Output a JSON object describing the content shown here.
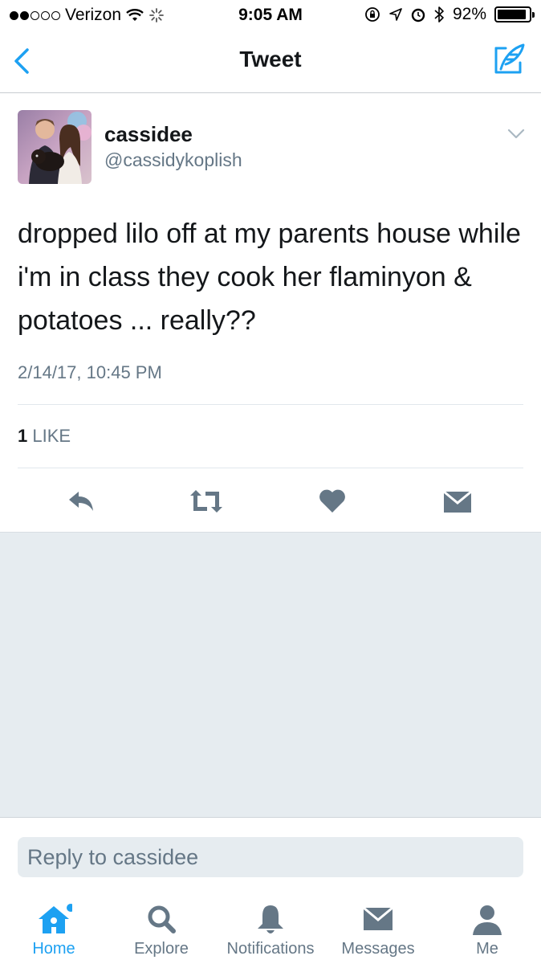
{
  "status_bar": {
    "carrier": "Verizon",
    "time": "9:05 AM",
    "battery": "92%",
    "battery_level": 0.92,
    "signal_bars_filled": 2,
    "signal_bars_total": 5
  },
  "nav": {
    "title": "Tweet"
  },
  "tweet": {
    "display_name": "cassidee",
    "handle": "@cassidykoplish",
    "text": "dropped lilo off at my parents house while i'm in class they cook her flaminyon & potatoes ... really??",
    "timestamp": "2/14/17, 10:45 PM",
    "likes_count": "1",
    "likes_label": "LIKE"
  },
  "reply": {
    "placeholder": "Reply to cassidee"
  },
  "tabs": [
    {
      "label": "Home",
      "icon": "home-icon",
      "active": true
    },
    {
      "label": "Explore",
      "icon": "search-icon",
      "active": false
    },
    {
      "label": "Notifications",
      "icon": "bell-icon",
      "active": false
    },
    {
      "label": "Messages",
      "icon": "envelope-icon",
      "active": false
    },
    {
      "label": "Me",
      "icon": "person-icon",
      "active": false
    }
  ],
  "colors": {
    "accent": "#1da1f2",
    "secondary_text": "#657786",
    "icon_grey": "#657786",
    "background_grey": "#e6ecf0"
  }
}
